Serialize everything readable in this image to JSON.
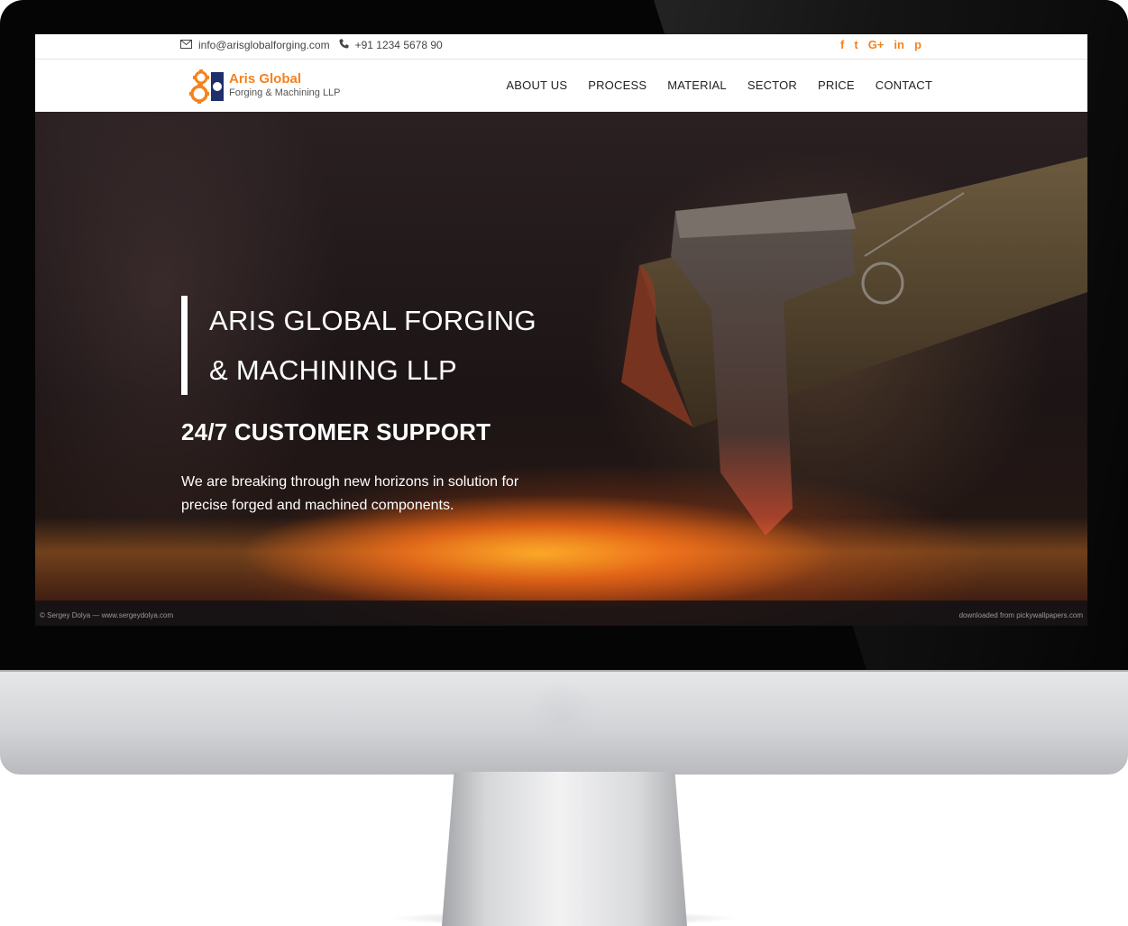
{
  "topbar": {
    "email": "info@arisglobalforging.com",
    "phone": "+91 1234 5678 90",
    "icons": {
      "email": "envelope-icon",
      "phone": "phone-icon"
    },
    "social": [
      {
        "name": "facebook-icon",
        "glyph": "f"
      },
      {
        "name": "twitter-icon",
        "glyph": "t"
      },
      {
        "name": "google-plus-icon",
        "glyph": "G+"
      },
      {
        "name": "linkedin-icon",
        "glyph": "in"
      },
      {
        "name": "pinterest-icon",
        "glyph": "p"
      }
    ]
  },
  "brand": {
    "name": "Aris Global",
    "subtitle": "Forging & Machining LLP",
    "accent_color": "#f5821f",
    "logo_icon": "gears-logo-icon"
  },
  "nav": {
    "items": [
      "ABOUT US",
      "PROCESS",
      "MATERIAL",
      "SECTOR",
      "PRICE",
      "CONTACT"
    ]
  },
  "hero": {
    "title_line1": "ARIS GLOBAL FORGING",
    "title_line2": "& MACHINING LLP",
    "subtitle": "24/7 CUSTOMER SUPPORT",
    "text": "We are breaking through new horizons in solution for precise forged and machined components.",
    "credit_left": "© Sergey Dolya — www.sergeydolya.com",
    "credit_right": "downloaded from pickywallpapers.com"
  }
}
